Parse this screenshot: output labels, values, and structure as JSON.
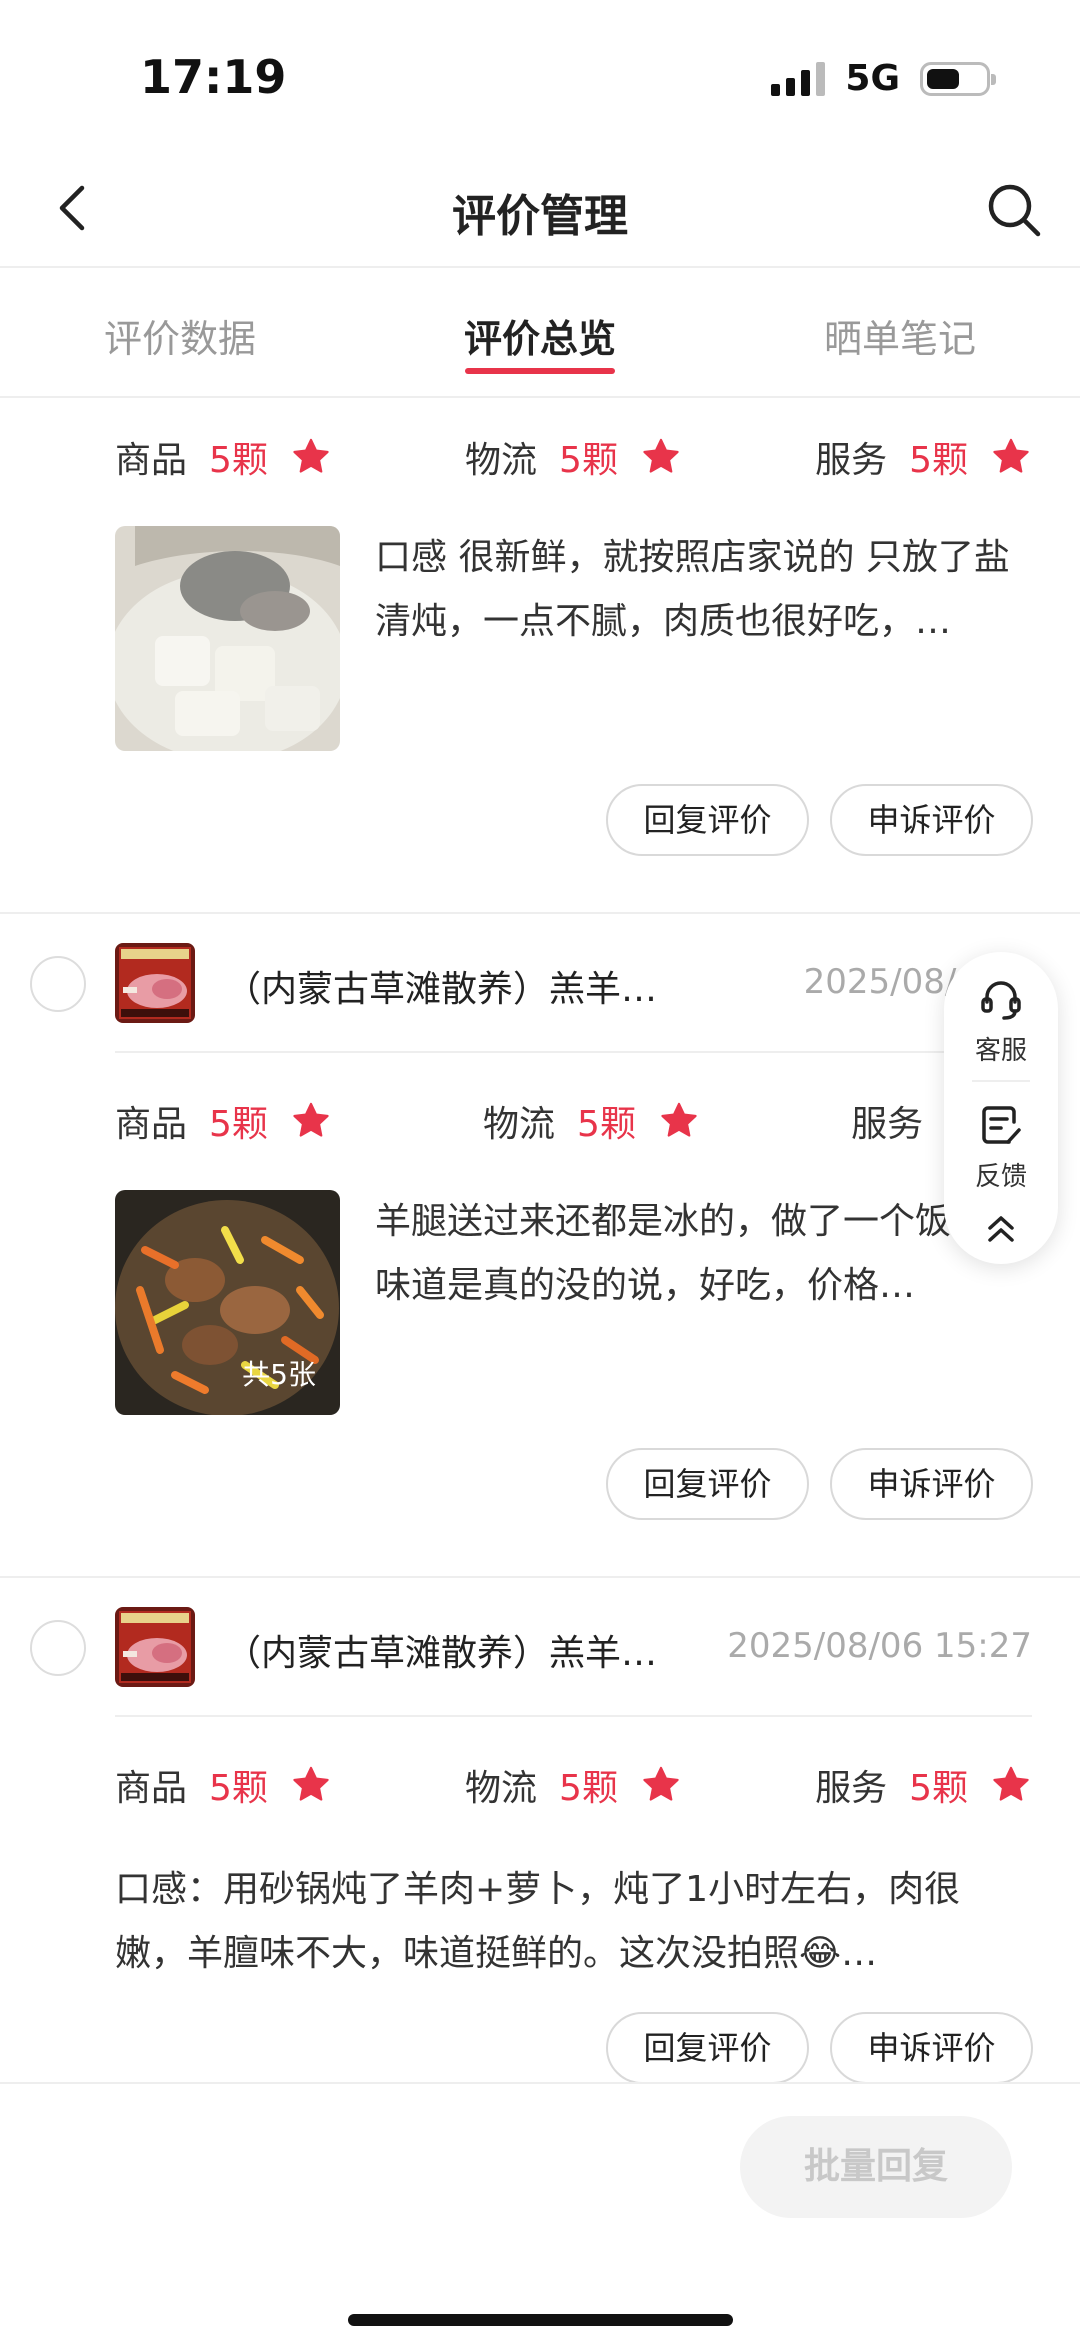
{
  "status_bar": {
    "time": "17:19",
    "network": "5G"
  },
  "nav": {
    "title": "评价管理"
  },
  "tabs": [
    {
      "label": "评价数据"
    },
    {
      "label": "评价总览"
    },
    {
      "label": "晒单笔记"
    }
  ],
  "active_tab": "评价总览",
  "rating_labels": {
    "product": "商品",
    "logistics": "物流",
    "service": "服务"
  },
  "reviews": [
    {
      "ratings": {
        "product": "5颗",
        "logistics": "5颗",
        "service": "5颗"
      },
      "text": "口感 很新鲜，就按照店家说的 只放了盐清炖，一点不腻，肉质也很好吃，…",
      "reply_label": "回复评价",
      "appeal_label": "申诉评价"
    },
    {
      "product_name": "（内蒙古草滩散养）羔羊…",
      "date": "2025/08/08 1",
      "ratings": {
        "product": "5颗",
        "logistics": "5颗",
        "service": "5"
      },
      "text": "羊腿送过来还都是冰的，做了一个饭，味道是真的没的说，好吃，价格…",
      "image_count": "共5张",
      "reply_label": "回复评价",
      "appeal_label": "申诉评价"
    },
    {
      "product_name": "（内蒙古草滩散养）羔羊…",
      "date": "2025/08/06 15:27",
      "ratings": {
        "product": "5颗",
        "logistics": "5颗",
        "service": "5颗"
      },
      "text": "口感：用砂锅炖了羊肉+萝卜，炖了1小时左右，肉很嫩，羊膻味不大，味道挺鲜的。这次没拍照😂…",
      "reply_label": "回复评价",
      "appeal_label": "申诉评价"
    }
  ],
  "float_widget": {
    "service_label": "客服",
    "feedback_label": "反馈"
  },
  "bottom": {
    "batch_reply_label": "批量回复"
  },
  "colors": {
    "accent": "#e8344a",
    "muted": "#999999",
    "disabled_bg": "#f3f3f3"
  },
  "icons": [
    "back-arrow-icon",
    "search-icon",
    "star-icon",
    "headset-icon",
    "feedback-edit-icon",
    "double-chevron-up-icon"
  ]
}
